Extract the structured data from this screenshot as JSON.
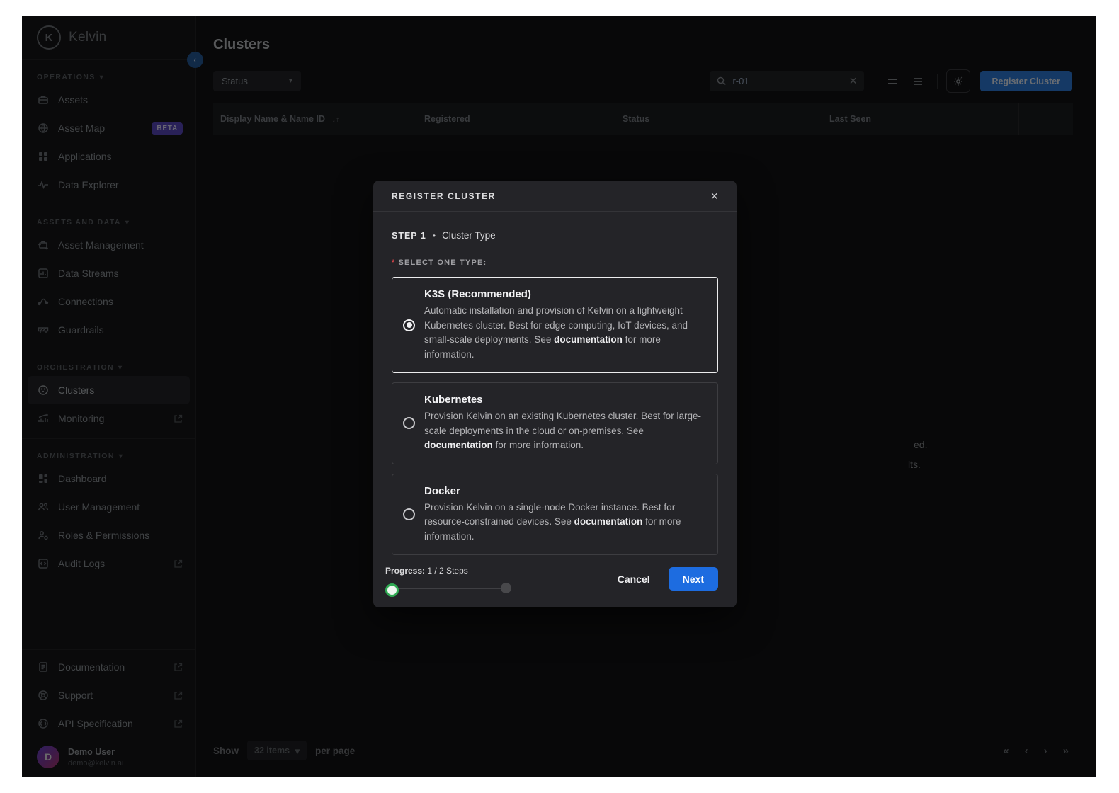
{
  "logo": {
    "wordmark": "Kelvin",
    "monogram": "K"
  },
  "sidebar": {
    "sections": [
      {
        "label": "OPERATIONS",
        "items": [
          {
            "label": "Assets"
          },
          {
            "label": "Asset Map",
            "badge": "BETA"
          },
          {
            "label": "Applications"
          },
          {
            "label": "Data Explorer"
          }
        ]
      },
      {
        "label": "ASSETS AND DATA",
        "items": [
          {
            "label": "Asset Management"
          },
          {
            "label": "Data Streams"
          },
          {
            "label": "Connections"
          },
          {
            "label": "Guardrails"
          }
        ]
      },
      {
        "label": "ORCHESTRATION",
        "items": [
          {
            "label": "Clusters",
            "active": true
          },
          {
            "label": "Monitoring",
            "external": true
          }
        ]
      },
      {
        "label": "ADMINISTRATION",
        "items": [
          {
            "label": "Dashboard"
          },
          {
            "label": "User Management"
          },
          {
            "label": "Roles & Permissions"
          },
          {
            "label": "Audit Logs",
            "external": true
          }
        ]
      }
    ],
    "footer_links": [
      {
        "label": "Documentation",
        "external": true
      },
      {
        "label": "Support",
        "external": true
      },
      {
        "label": "API Specification",
        "external": true
      }
    ],
    "user": {
      "initial": "D",
      "name": "Demo User",
      "email": "demo@kelvin.ai"
    }
  },
  "header": {
    "title": "Clusters",
    "status_filter_label": "Status",
    "search_value": "r-01",
    "register_button": "Register Cluster"
  },
  "table": {
    "columns": [
      "Display Name & Name ID",
      "Registered",
      "Status",
      "Last Seen"
    ],
    "sort_glyph": "↓↑",
    "empty_state_fragments": [
      "ed.",
      "lts."
    ]
  },
  "pagination": {
    "show_label": "Show",
    "page_size_value": "32 items",
    "per_page_label": "per page",
    "first": "«",
    "prev": "‹",
    "next": "›",
    "last": "»"
  },
  "modal": {
    "title": "REGISTER CLUSTER",
    "close_glyph": "×",
    "step_label": "STEP 1",
    "step_separator": "•",
    "step_name": "Cluster Type",
    "required_mark": "*",
    "select_prompt": "SELECT ONE TYPE:",
    "options": [
      {
        "title": "K3S (Recommended)",
        "desc_pre": "Automatic installation and provision of Kelvin on a lightweight Kubernetes cluster. Best for edge computing, IoT devices, and small-scale deployments. See ",
        "desc_link": "documentation",
        "desc_post": " for more information.",
        "selected": true
      },
      {
        "title": "Kubernetes",
        "desc_pre": "Provision Kelvin on an existing Kubernetes cluster. Best for large-scale deployments in the cloud or on-premises. See ",
        "desc_link": "documentation",
        "desc_post": " for more information.",
        "selected": false
      },
      {
        "title": "Docker",
        "desc_pre": "Provision Kelvin on a single-node Docker instance. Best for resource-constrained devices. See ",
        "desc_link": "documentation",
        "desc_post": " for more information.",
        "selected": false
      }
    ],
    "progress_label": "Progress:",
    "progress_value": "1 / 2 Steps",
    "cancel_button": "Cancel",
    "next_button": "Next"
  },
  "colors": {
    "accent_blue": "#1d6ce0",
    "progress_green": "#2faa53",
    "beta_purple": "#5b4bc4",
    "required_red": "#e5484d"
  }
}
